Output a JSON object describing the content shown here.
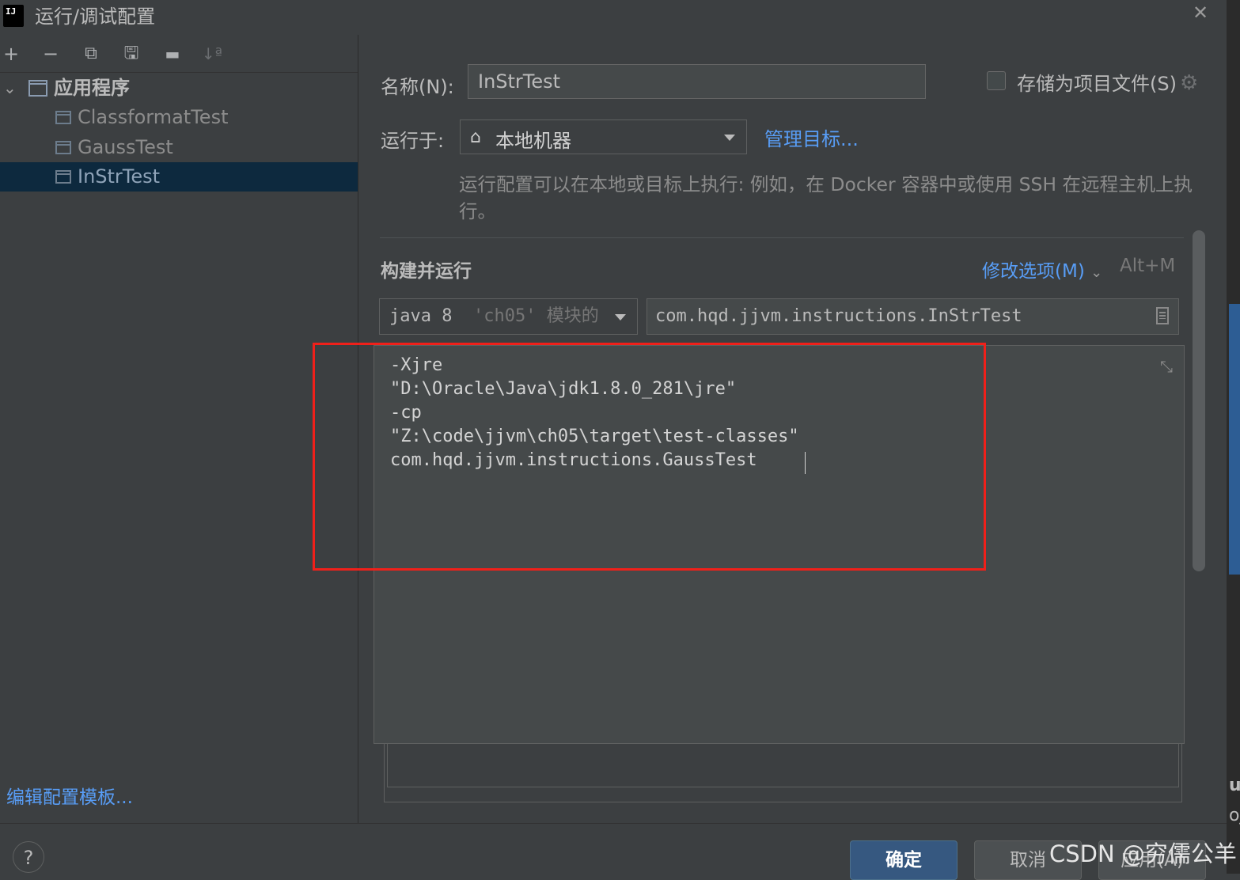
{
  "window": {
    "title": "运行/调试配置",
    "app_icon_text": "IJ",
    "close_glyph": "✕"
  },
  "toolbar": {
    "add": "+",
    "remove": "−",
    "copy": "⧉",
    "save": "🖫",
    "folder": "▬",
    "sort": "↓ª"
  },
  "tree": {
    "group_label": "应用程序",
    "items": [
      {
        "label": "ClassformatTest"
      },
      {
        "label": "GaussTest"
      },
      {
        "label": "InStrTest"
      }
    ],
    "edit_templates_link": "编辑配置模板..."
  },
  "form": {
    "name_label": "名称(N):",
    "name_value": "InStrTest",
    "store_as_project_file": "存储为项目文件(S)",
    "run_on_label": "运行于:",
    "run_on_value": "本地机器",
    "manage_targets": "管理目标...",
    "hint": "运行配置可以在本地或目标上执行: 例如，在 Docker 容器中或使用 SSH 在远程主机上执行。",
    "section_title": "构建并运行",
    "modify_options": "修改选项(M)",
    "modify_options_shortcut": "Alt+M",
    "jre_value": "java 8",
    "jre_module": "'ch05' 模块的",
    "main_class": "com.hqd.jjvm.instructions.InStrTest",
    "program_arguments": [
      "-Xjre",
      "\"D:\\Oracle\\Java\\jdk1.8.0_281\\jre\"",
      "-cp",
      "\"Z:\\code\\jjvm\\ch05\\target\\test-classes\"",
      "com.hqd.jjvm.instructions.GaussTest"
    ]
  },
  "buttons": {
    "help": "?",
    "ok": "确定",
    "cancel": "取消",
    "apply": "应用(A)"
  },
  "watermark": "CSDN @穷儒公羊",
  "edge_text": [
    "u",
    "oj"
  ],
  "colors": {
    "background": "#3c3f41",
    "selection": "#0d293e",
    "link": "#589df6",
    "primary_button": "#365880",
    "highlight_box": "#f0201a"
  }
}
